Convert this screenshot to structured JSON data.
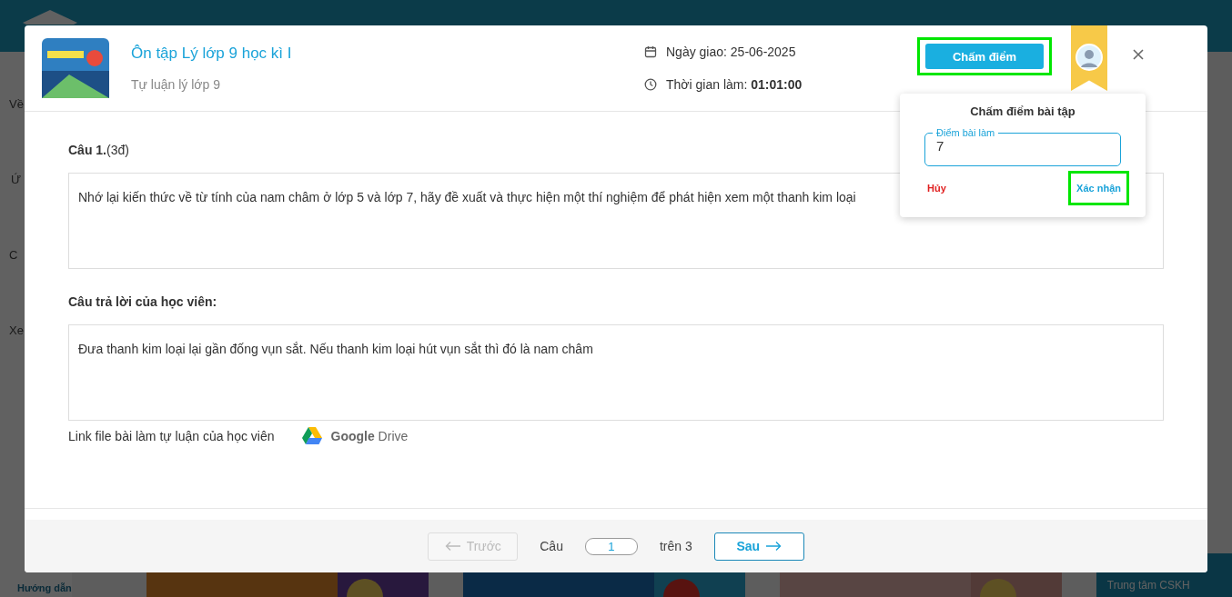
{
  "background": {
    "sidebar_items": [
      "Về",
      "Ứ",
      "C",
      "Xe"
    ],
    "help_link": "Hướng dẫn",
    "support": "Trung tâm CSKH"
  },
  "header": {
    "title": "Ôn tập Lý lớp 9 học kì I",
    "subtitle": "Tự luận lý lớp 9",
    "assigned": "Ngày giao: 25-06-2025",
    "duration": "Thời gian làm: **01:01:00**",
    "grade_button": {
      "label": "Chấm điểm",
      "highlighted": true
    }
  },
  "question": {
    "heading": "**Câu 1.**(3đ)",
    "text": "Nhớ lại kiến thức về từ tính của nam châm ở lớp 5 và lớp 7, hãy đề xuất và thực hiện một thí nghiệm để phát hiện xem một thanh kim loại"
  },
  "answer": {
    "heading": "Câu trả lời của học viên:",
    "text": "Đưa thanh kim loại lại gần đống vụn sắt. Nếu thanh kim loại hút vụn sắt thì đó là nam châm"
  },
  "file_link": {
    "label": "Link file bài làm tự luận của học viên",
    "service": "**Google** Drive"
  },
  "pager": {
    "prev": {
      "label": "Trước",
      "disabled": true
    },
    "word": "Câu",
    "current": "1",
    "total": "trên 3",
    "next": {
      "label": "Sau",
      "disabled": false
    }
  },
  "popover": {
    "title": "Chấm điểm bài tập",
    "field_label": "Điểm bài làm",
    "value": "7",
    "cancel": "Hủy",
    "confirm": {
      "label": "Xác nhận",
      "highlighted": true
    }
  }
}
